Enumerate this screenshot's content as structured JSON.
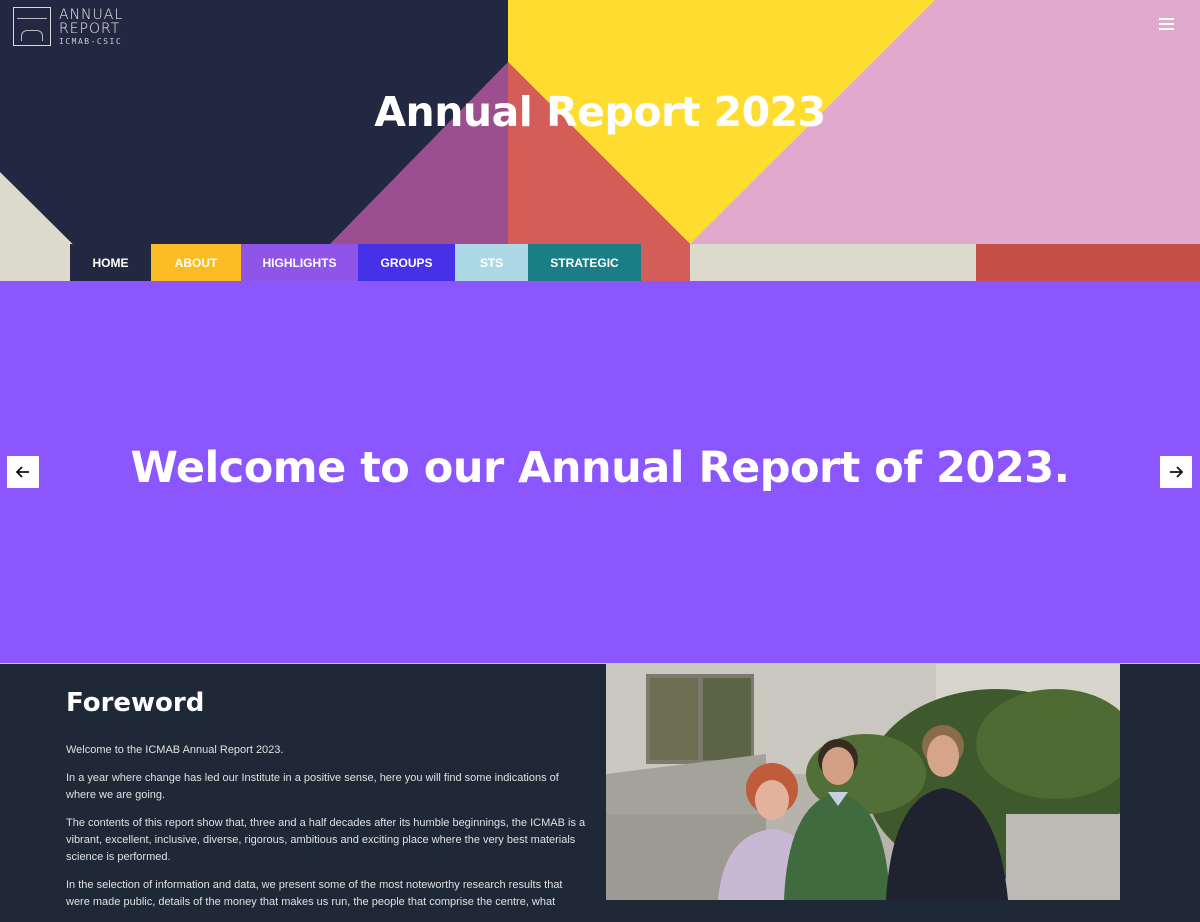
{
  "header": {
    "logo_line1": "ANNUAL",
    "logo_line2": "REPORT",
    "logo_line3": "ICMAB-CSIC",
    "title": "Annual Report 2023",
    "menu_icon": "hamburger-menu-icon"
  },
  "nav": {
    "items": [
      {
        "label": "HOME",
        "color": "#222841"
      },
      {
        "label": "ABOUT",
        "color": "#fbbb22"
      },
      {
        "label": "HIGHLIGHTS",
        "color": "#8f55e9"
      },
      {
        "label": "GROUPS",
        "color": "#4630e8"
      },
      {
        "label": "STS",
        "color": "#add8e6"
      },
      {
        "label": "STRATEGIC",
        "color": "#1b7d85"
      }
    ]
  },
  "hero_colors": {
    "navy": "#222841",
    "yellow": "#ffdd30",
    "pink": "#e2a9cf",
    "coral": "#d45d5a",
    "purple": "#9c4f8f",
    "beige": "#dcd9cd",
    "red": "#c65048"
  },
  "slider": {
    "text": "Welcome to our Annual Report of 2023.",
    "background": "#8c56fe",
    "prev_icon": "arrow-left-icon",
    "next_icon": "arrow-right-icon"
  },
  "foreword": {
    "title": "Foreword",
    "paragraphs": [
      "Welcome to the ICMAB Annual Report 2023.",
      "In a year where change has led our Institute in a positive sense, here you will find some indications of where we are going.",
      "The contents of this report show that, three and a half decades after its humble beginnings, the ICMAB is a vibrant, excellent, inclusive, diverse, rigorous, ambitious and exciting place where the very best materials science is performed.",
      "In the selection of information and data, we present some of the most noteworthy research results that were made public, details of the money that makes us run, the people that comprise the centre, what"
    ]
  }
}
